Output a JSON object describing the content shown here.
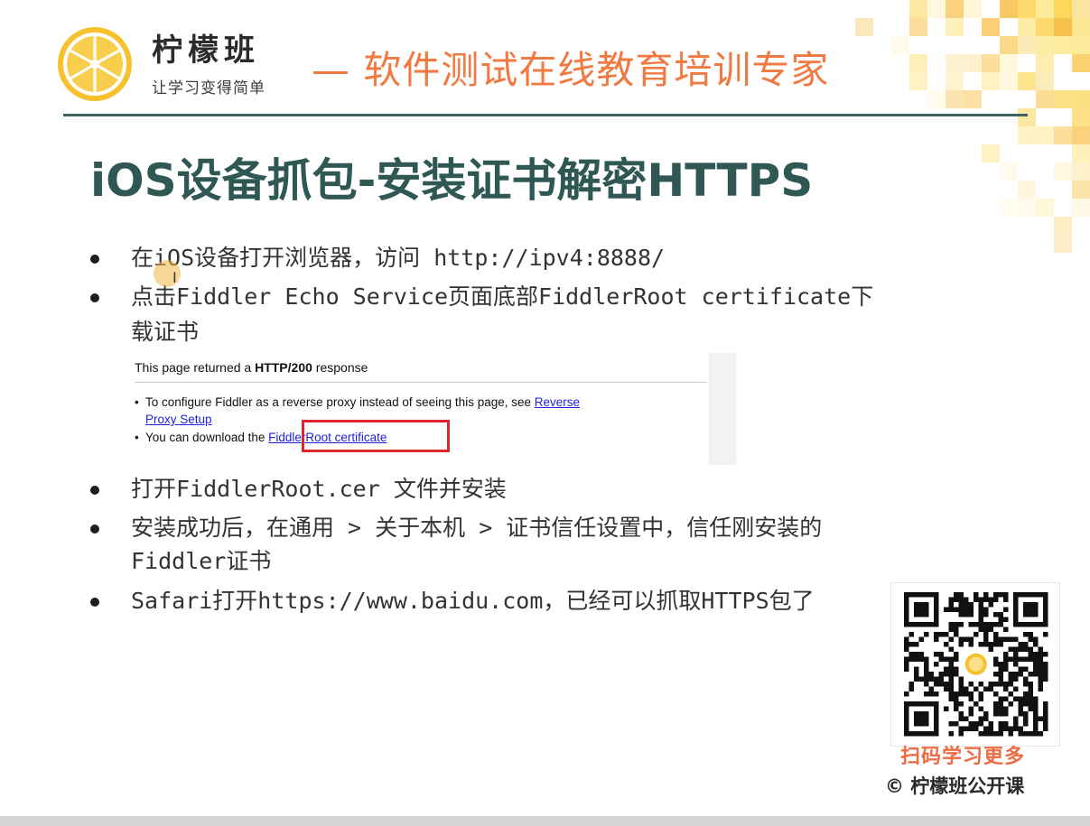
{
  "header": {
    "brand_name": "柠檬班",
    "brand_slogan": "让学习变得简单",
    "tagline": "— 软件测试在线教育培训专家"
  },
  "slide": {
    "title": "iOS设备抓包-安装证书解密HTTPS",
    "bullets": [
      "在iOS设备打开浏览器，访问 http://ipv4:8888/",
      "点击Fiddler Echo Service页面底部FiddlerRoot certificate下",
      "载证书",
      "打开FiddlerRoot.cer 文件并安装",
      "安装成功后，在通用 > 关于本机 > 证书信任设置中，信任刚安装的",
      "Fiddler证书",
      "Safari打开https://www.baidu.com，已经可以抓取HTTPS包了"
    ]
  },
  "embed": {
    "heading_prefix": "This page returned a ",
    "heading_bold": "HTTP/200",
    "heading_suffix": " response",
    "item1_text": "To configure Fiddler as a reverse proxy instead of seeing this page, see ",
    "item1_link_a": "Reverse",
    "item1_link_b": "Proxy Setup",
    "item2_text": "You can download the ",
    "item2_link": "FiddlerRoot certificate"
  },
  "qr": {
    "caption": "扫码学习更多",
    "icon": "qr-code-icon"
  },
  "footer": {
    "copyright": "© 柠檬班公开课"
  },
  "colors": {
    "accent_orange": "#f07a42",
    "title_teal": "#2f5855",
    "highlight_red": "#d9272e",
    "link_blue": "#2020dd",
    "lemon_yellow": "#f6c12c"
  }
}
